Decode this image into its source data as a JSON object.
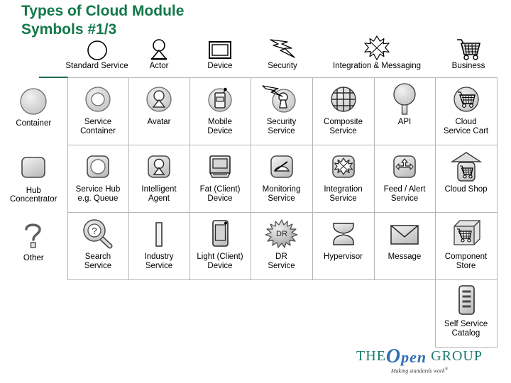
{
  "title": {
    "line1": "Types of Cloud Module",
    "line2": "Symbols #1/3",
    "color": "#13784a"
  },
  "header": {
    "columns": [
      {
        "label": "Standard Service",
        "icon": "circle-outline-icon"
      },
      {
        "label": "Actor",
        "icon": "actor-icon"
      },
      {
        "label": "Device",
        "icon": "device-screen-icon"
      },
      {
        "label": "Security",
        "icon": "lightning-bolt-icon"
      },
      {
        "label": "Integration & Messaging",
        "icon": "eight-point-star-icon"
      },
      {
        "label": "Business",
        "icon": "shopping-cart-icon"
      }
    ]
  },
  "rows": [
    {
      "label": "Container",
      "label_icon": "filled-circle-icon",
      "cells": [
        {
          "label": "Service\nContainer",
          "icon": "donut-circle-icon"
        },
        {
          "label": "Avatar",
          "icon": "avatar-circle-icon"
        },
        {
          "label": "Mobile\nDevice",
          "icon": "mobile-device-circle-icon"
        },
        {
          "label": "Security\nService",
          "icon": "keyhole-bolt-circle-icon"
        },
        {
          "label": "Composite\nService",
          "icon": "grid-sphere-icon"
        },
        {
          "label": "API",
          "icon": "lollipop-api-icon"
        },
        {
          "label": "Cloud\nService Cart",
          "icon": "cart-circle-icon"
        }
      ]
    },
    {
      "label": "Hub\nConcentrator",
      "label_icon": "rounded-square-icon",
      "cells": [
        {
          "label": "Service Hub\ne.g. Queue",
          "icon": "rounded-square-circle-icon"
        },
        {
          "label": "Intelligent\nAgent",
          "icon": "rounded-square-avatar-icon"
        },
        {
          "label": "Fat (Client)\nDevice",
          "icon": "desktop-computer-icon"
        },
        {
          "label": "Monitoring\nService",
          "icon": "gauge-icon"
        },
        {
          "label": "Integration\nService",
          "icon": "rounded-square-star-icon"
        },
        {
          "label": "Feed / Alert\nService",
          "icon": "feed-arrows-icon"
        },
        {
          "label": "Cloud Shop",
          "icon": "shop-cart-roof-icon"
        }
      ]
    },
    {
      "label": "Other",
      "label_icon": "question-mark-icon",
      "cells": [
        {
          "label": "Search\nService",
          "icon": "magnifier-question-icon"
        },
        {
          "label": "Industry\nService",
          "icon": "vertical-bar-icon"
        },
        {
          "label": "Light (Client)\nDevice",
          "icon": "tablet-device-icon"
        },
        {
          "label": "DR\nService",
          "icon": "burst-dr-icon",
          "icon_text": "DR"
        },
        {
          "label": "Hypervisor",
          "icon": "hourglass-hypervisor-icon"
        },
        {
          "label": "Message",
          "icon": "envelope-icon"
        },
        {
          "label": "Component\nStore",
          "icon": "cube-cart-icon"
        }
      ]
    },
    {
      "label": "",
      "label_icon": "",
      "cells": [
        {
          "label": "",
          "icon": ""
        },
        {
          "label": "",
          "icon": ""
        },
        {
          "label": "",
          "icon": ""
        },
        {
          "label": "",
          "icon": ""
        },
        {
          "label": "",
          "icon": ""
        },
        {
          "label": "",
          "icon": ""
        },
        {
          "label": "Self Service\nCatalog",
          "icon": "catalog-list-icon"
        }
      ]
    }
  ],
  "logo": {
    "the": "THE",
    "o": "O",
    "pen": "pen",
    "group": "GROUP",
    "tagline": "Making standards work",
    "tagline_sup": "®"
  }
}
